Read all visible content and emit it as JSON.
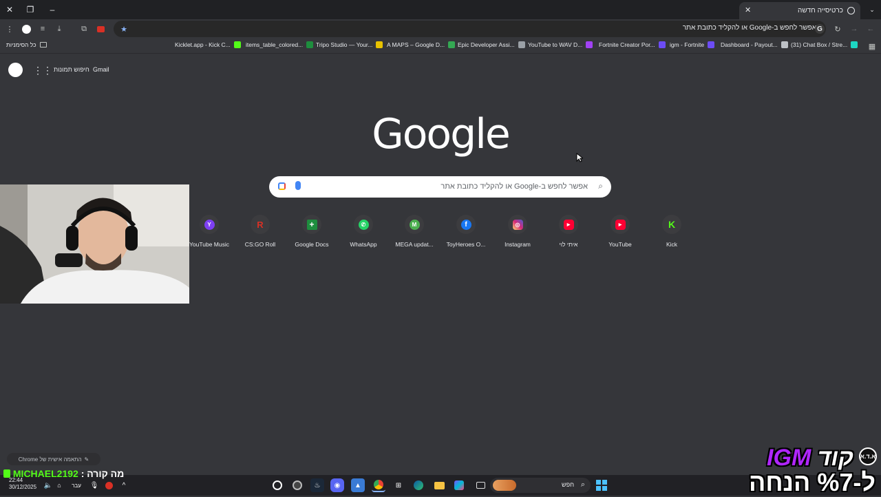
{
  "window": {
    "tab_title": "כרטיסייה חדשה",
    "omnibox_text": "אפשר לחפש ב-Google או להקליד כתובת אתר"
  },
  "bookmarks_bar": {
    "all_bookmarks": "כל הסימניות",
    "items": [
      {
        "label": "Kicklet.app - Kick C...",
        "color": "#53fc18"
      },
      {
        "label": "items_table_colored...",
        "color": "#1e8e3e"
      },
      {
        "label": "Tripo Studio — Your...",
        "color": "#e8c200"
      },
      {
        "label": "A MAPS – Google D...",
        "color": "#34a853"
      },
      {
        "label": "Epic Developer Assi...",
        "color": "#9aa0a6"
      },
      {
        "label": "YouTube to WAV D...",
        "color": "#a142f4"
      },
      {
        "label": "Fortnite Creator Por...",
        "color": "#6c4cf5"
      },
      {
        "label": "igm - Fortnite",
        "color": "#6c4cf5"
      },
      {
        "label": "Dashboard - Payout...",
        "color": "#bdc1c6"
      },
      {
        "label": "(31) Chat Box / Stre...",
        "color": "#1dd6c2"
      }
    ]
  },
  "top_links": {
    "gmail": "Gmail",
    "images": "חיפוש תמונות"
  },
  "logo_text": "Google",
  "search": {
    "placeholder": "אפשר לחפש ב-Google או להקליד כתובת אתר"
  },
  "shortcuts": [
    {
      "label": "YouTube Music",
      "icon": "youtube-music-icon",
      "color": "#7e3ff2",
      "glyph": "Y"
    },
    {
      "label": "CS:GO Roll",
      "icon": "csgoroll-icon",
      "color": "#d93025",
      "glyph": "R"
    },
    {
      "label": "Google Docs",
      "icon": "google-docs-icon",
      "color": "#1e8e3e",
      "glyph": "+"
    },
    {
      "label": "WhatsApp",
      "icon": "whatsapp-icon",
      "color": "#25d366",
      "glyph": "✆"
    },
    {
      "label": "MEGA updat...",
      "icon": "mega-icon",
      "color": "#4caf50",
      "glyph": "M"
    },
    {
      "label": "ToyHeroes O...",
      "icon": "facebook-icon",
      "color": "#1877f2",
      "glyph": "f"
    },
    {
      "label": "Instagram",
      "icon": "instagram-icon",
      "color": "#e1306c",
      "glyph": "◎"
    },
    {
      "label": "איתי לוי",
      "icon": "youtube-channel-icon",
      "color": "#ff0033",
      "glyph": "▶"
    },
    {
      "label": "YouTube",
      "icon": "youtube-icon",
      "color": "#ff0033",
      "glyph": "▶"
    },
    {
      "label": "Kick",
      "icon": "kick-icon",
      "color": "#53fc18",
      "glyph": "K"
    }
  ],
  "customize_chrome": "התאמה אישית של Chrome",
  "chat": {
    "username": "MICHAEL2192",
    "separator": " : ",
    "message": "מה קורה"
  },
  "taskbar": {
    "search_placeholder": "חפש",
    "language": "עבר",
    "time": "22:44",
    "date": "30/12/2025"
  },
  "promo": {
    "brand": "IGM",
    "code_word": "קוד",
    "discount_line": "ל-%7 הנחה",
    "badge": "א.ד.א"
  },
  "colors": {
    "page_bg": "#35363a",
    "titlebar_bg": "#202124",
    "kick_green": "#53fc18",
    "brand_purple": "#b026ff"
  }
}
